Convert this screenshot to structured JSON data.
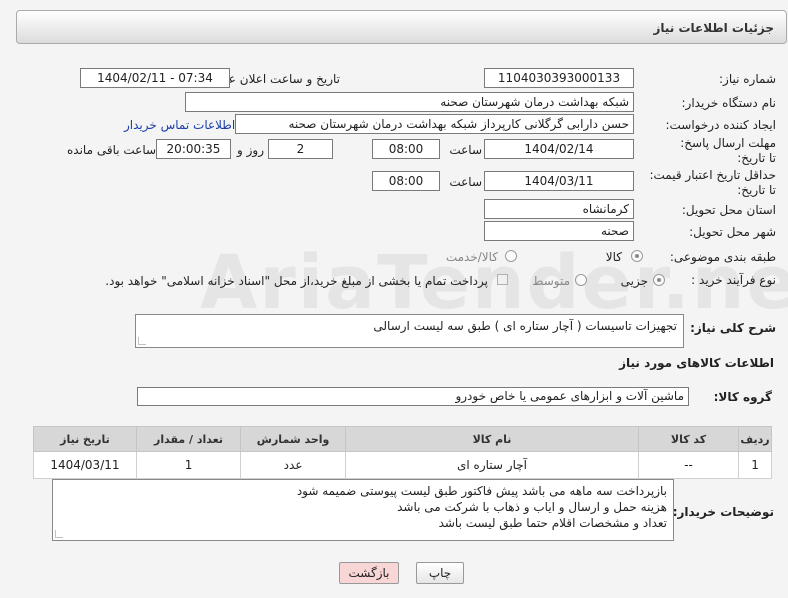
{
  "header": {
    "title": "جزئیات اطلاعات نیاز"
  },
  "fields": {
    "need_number_label": "شماره نیاز:",
    "need_number": "1104030393000133",
    "announce_label": "تاریخ و ساعت اعلان عمومی:",
    "announce_value": "1404/02/11 - 07:34",
    "buyer_org_label": "نام دستگاه خریدار:",
    "buyer_org": "شبکه بهداشت درمان شهرستان صحنه",
    "creator_label": "ایجاد کننده درخواست:",
    "creator": "حسن دارابی گرگلانی کارپرداز شبکه بهداشت درمان شهرستان صحنه",
    "contact_link": "اطلاعات تماس خریدار",
    "reply_deadline_label": "مهلت ارسال پاسخ: تا تاریخ:",
    "reply_date": "1404/02/14",
    "time_label": "ساعت",
    "reply_time": "08:00",
    "day_and_label": "روز و",
    "reply_days": "2",
    "remaining_time": "20:00:35",
    "remaining_label": "ساعت باقی مانده",
    "price_validity_label": "حداقل تاریخ اعتبار قیمت: تا تاریخ:",
    "price_date": "1404/03/11",
    "price_time": "08:00",
    "province_label": "استان محل تحویل:",
    "province": "کرمانشاه",
    "city_label": "شهر محل تحویل:",
    "city": "صحنه",
    "category_label": "طبقه بندی موضوعی:",
    "category_goods": "کالا",
    "category_goods_service": "کالا/خدمت",
    "process_label": "نوع فرآیند خرید :",
    "process_partial": "جزیی",
    "process_medium": "متوسط",
    "payment_note": "پرداخت تمام یا بخشی از مبلغ خرید،از محل \"اسناد خزانه اسلامی\" خواهد بود."
  },
  "description": {
    "label": "شرح کلی نیاز:",
    "text": "تجهیزات تاسیسات ( آچار ستاره ای ) طبق سه لیست ارسالی"
  },
  "goods_section": {
    "title": "اطلاعات کالاهای مورد نیاز",
    "group_label": "گروه کالا:",
    "group_value": "ماشین آلات و ابزارهای عمومی یا خاص خودرو"
  },
  "table": {
    "headers": [
      "ردیف",
      "کد کالا",
      "نام کالا",
      "واحد شمارش",
      "تعداد / مقدار",
      "تاریخ نیاز"
    ],
    "rows": [
      {
        "row": "1",
        "code": "--",
        "name": "آچار ستاره ای",
        "unit": "عدد",
        "qty": "1",
        "date": "1404/03/11"
      }
    ]
  },
  "buyer_notes": {
    "label": "توضیحات خریدار:",
    "line1": "بازپرداخت سه ماهه می باشد پیش فاکتور طبق لیست پیوستی ضمیمه شود",
    "line2": "هزینه حمل و ارسال و ایاب و ذهاب با شرکت می باشد",
    "line3": "تعداد و مشخصات اقلام حتما طبق لیست باشد"
  },
  "buttons": {
    "print": "چاپ",
    "back": "بازگشت"
  },
  "colors": {
    "link": "#1a3ea8",
    "back_button_bg": "#f9d6d6",
    "table_header": "#d7d7d7"
  }
}
